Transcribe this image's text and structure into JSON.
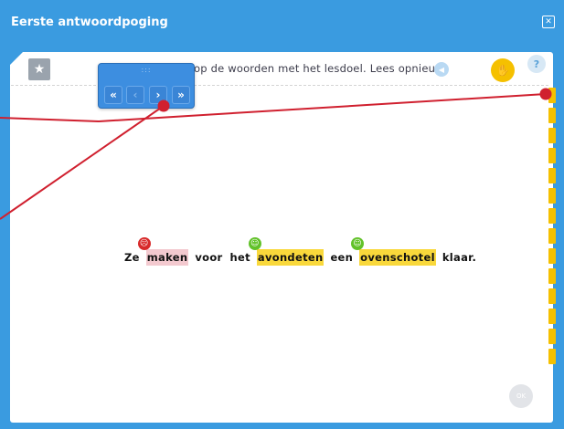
{
  "window": {
    "title": "Eerste antwoordpoging"
  },
  "instruction": {
    "text": "op de woorden met het lesdoel. Lees opnieuw."
  },
  "navigation": {
    "grip": ":::",
    "first": "«",
    "prev": "‹",
    "next": "›",
    "last": "»"
  },
  "sentence": {
    "words": [
      {
        "text": "Ze",
        "state": "plain"
      },
      {
        "text": "maken",
        "state": "wrong"
      },
      {
        "text": "voor",
        "state": "plain"
      },
      {
        "text": "het",
        "state": "plain"
      },
      {
        "text": "avondeten",
        "state": "correct"
      },
      {
        "text": "een",
        "state": "plain"
      },
      {
        "text": "ovenschotel",
        "state": "correct"
      },
      {
        "text": "klaar.",
        "state": "plain"
      }
    ]
  },
  "ok_button": {
    "label": "OK"
  },
  "help_button": {
    "label": "?"
  },
  "colors": {
    "accent": "#3a9be0",
    "wrong_highlight": "#f3c9cf",
    "correct_highlight": "#f9d83b",
    "wrong_smiley": "#d82a2a",
    "correct_smiley": "#62c22a",
    "pointer_line": "#d0202f"
  },
  "icons": {
    "close": "close-icon",
    "star": "star-icon",
    "audio": "speaker-icon",
    "hint": "hand-icon"
  }
}
